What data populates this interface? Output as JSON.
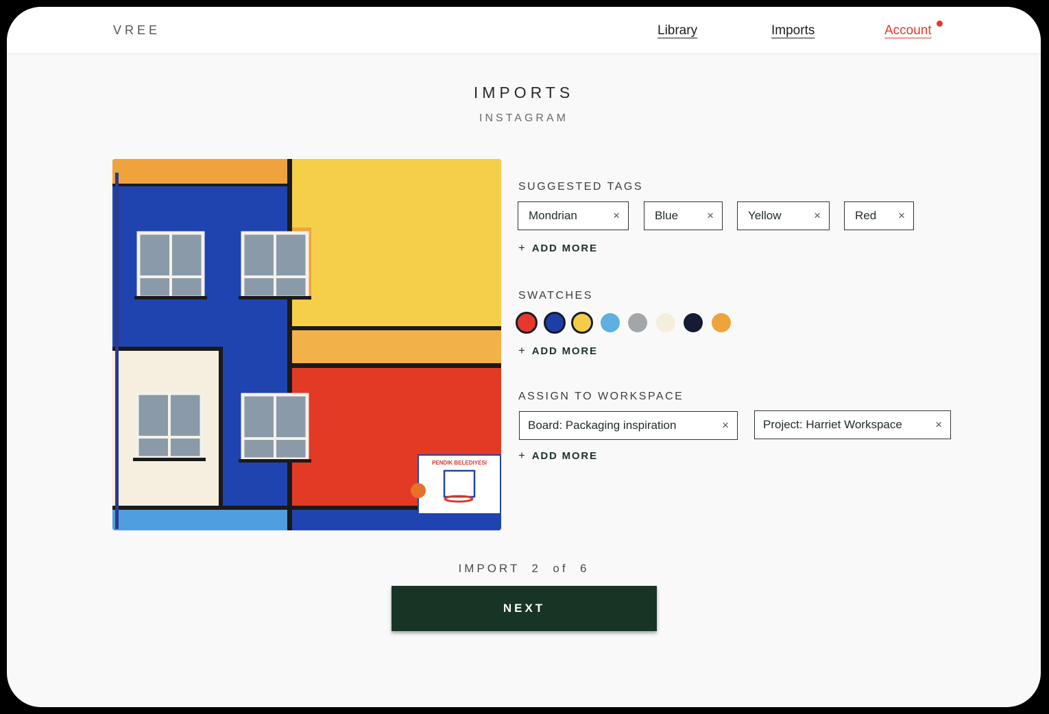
{
  "header": {
    "logo": "VREE",
    "nav": {
      "library": "Library",
      "imports": "Imports",
      "account": "Account"
    },
    "account_has_notification": true
  },
  "page": {
    "title": "IMPORTS",
    "subtitle": "INSTAGRAM"
  },
  "photo": {
    "sign_text": "PENDIK BELEDIYESI"
  },
  "suggested_tags": {
    "label": "SUGGESTED TAGS",
    "tags": [
      "Mondrian",
      "Blue",
      "Yellow",
      "Red"
    ],
    "add_more": "ADD MORE"
  },
  "swatches": {
    "label": "SWATCHES",
    "colors": [
      {
        "hex": "#e8382b",
        "selected": true
      },
      {
        "hex": "#1b3fa6",
        "selected": true
      },
      {
        "hex": "#f5cc4a",
        "selected": true
      },
      {
        "hex": "#5db0e0",
        "selected": false
      },
      {
        "hex": "#a3a6a9",
        "selected": false
      },
      {
        "hex": "#f6eedd",
        "selected": false
      },
      {
        "hex": "#141b33",
        "selected": false
      },
      {
        "hex": "#eea43a",
        "selected": false
      }
    ],
    "add_more": "ADD MORE"
  },
  "workspace": {
    "label": "ASSIGN TO WORKSPACE",
    "items": [
      "Board: Packaging inspiration",
      "Project: Harriet Workspace"
    ],
    "add_more": "ADD MORE"
  },
  "footer": {
    "counter": "IMPORT  2  of  6",
    "next_label": "NEXT"
  },
  "icons": {
    "remove": "×",
    "add": "+"
  },
  "colors": {
    "accent": "#e8372a",
    "primary_button": "#173425"
  }
}
